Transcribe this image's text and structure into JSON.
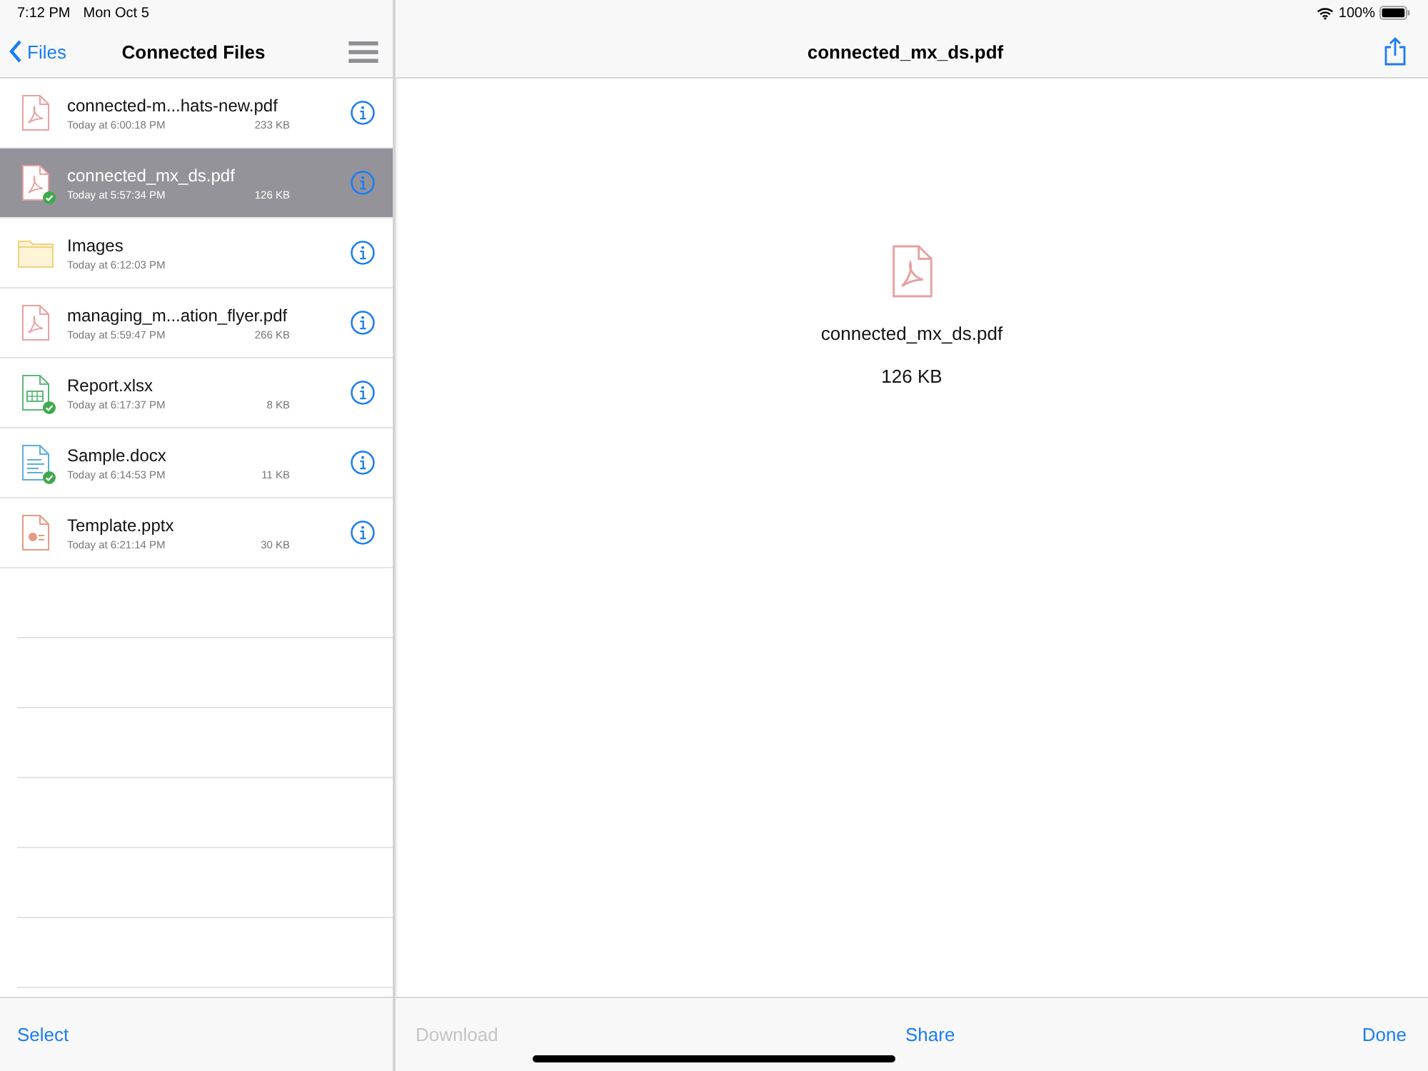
{
  "status_bar": {
    "time": "7:12 PM",
    "date": "Mon Oct 5",
    "battery_text": "100%"
  },
  "sidebar": {
    "back_label": "Files",
    "title": "Connected Files",
    "items": [
      {
        "kind": "pdf",
        "name": "connected-m...hats-new.pdf",
        "modified": "Today at 6:00:18 PM",
        "size": "233 KB",
        "synced": false,
        "selected": false
      },
      {
        "kind": "pdf",
        "name": "connected_mx_ds.pdf",
        "modified": "Today at 5:57:34 PM",
        "size": "126 KB",
        "synced": true,
        "selected": true
      },
      {
        "kind": "folder",
        "name": "Images",
        "modified": "Today at 6:12:03 PM",
        "synced": false,
        "selected": false
      },
      {
        "kind": "pdf",
        "name": "managing_m...ation_flyer.pdf",
        "modified": "Today at 5:59:47 PM",
        "size": "266 KB",
        "synced": false,
        "selected": false
      },
      {
        "kind": "xlsx",
        "name": "Report.xlsx",
        "modified": "Today at 6:17:37 PM",
        "size": "8 KB",
        "synced": true,
        "selected": false
      },
      {
        "kind": "docx",
        "name": "Sample.docx",
        "modified": "Today at 6:14:53 PM",
        "size": "11 KB",
        "synced": true,
        "selected": false
      },
      {
        "kind": "pptx",
        "name": "Template.pptx",
        "modified": "Today at 6:21:14 PM",
        "size": "30 KB",
        "synced": false,
        "selected": false
      }
    ],
    "toolbar": {
      "select_label": "Select"
    }
  },
  "preview": {
    "title": "connected_mx_ds.pdf",
    "kind": "pdf",
    "file_name": "connected_mx_ds.pdf",
    "file_size": "126 KB",
    "toolbar": [
      {
        "label": "Download",
        "disabled": true
      },
      {
        "label": "Share",
        "disabled": false
      },
      {
        "label": "Done",
        "disabled": false
      }
    ]
  }
}
